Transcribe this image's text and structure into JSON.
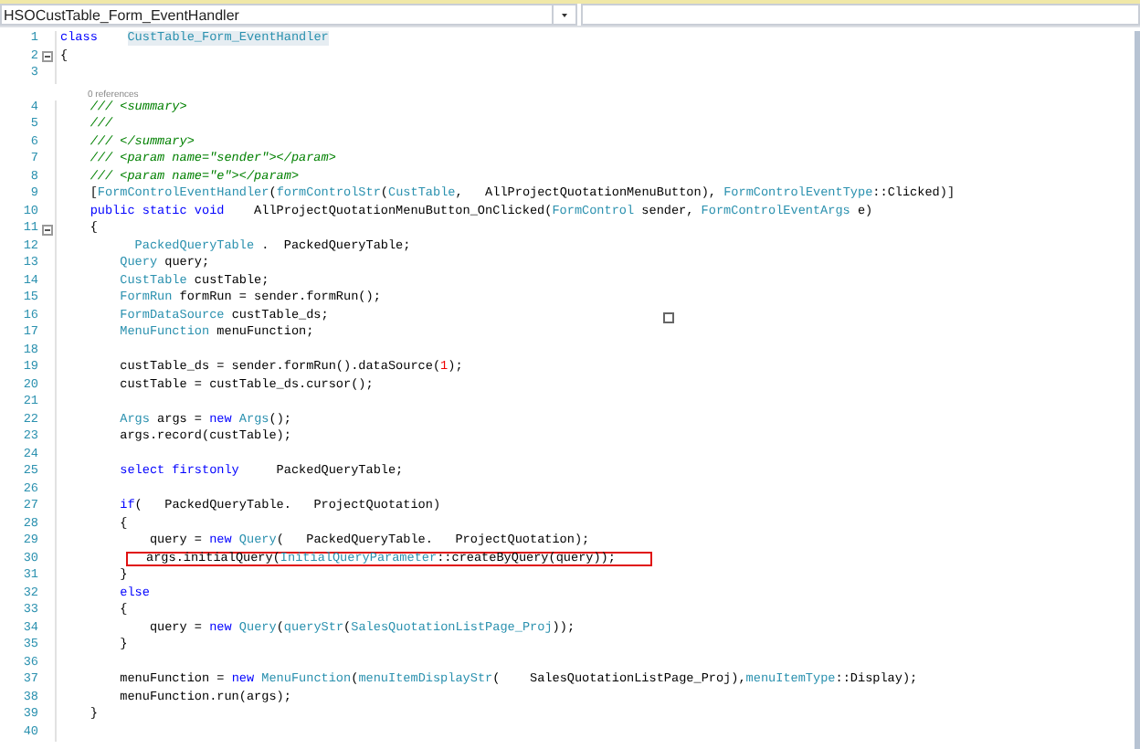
{
  "navigation": {
    "type_dropdown": "HSOCustTable_Form_EventHandler"
  },
  "editor": {
    "lines": [
      {
        "number": "1",
        "collapsible": false,
        "boxed": false,
        "tokens": [
          {
            "kind": "keyword",
            "text": "class    "
          },
          {
            "kind": "highlight",
            "text": "CustTable_Form_EventHandler"
          }
        ]
      },
      {
        "number": "2",
        "collapsible": true,
        "boxed": false,
        "tokens": [
          {
            "kind": "plain",
            "text": "{"
          }
        ]
      },
      {
        "number": "3",
        "collapsible": false,
        "boxed": false
      },
      {
        "number": "4",
        "collapsible": false,
        "boxed": false,
        "references": "0 references",
        "tokens": [
          {
            "kind": "comment",
            "text": "    /// <summary>"
          }
        ]
      },
      {
        "number": "5",
        "collapsible": false,
        "boxed": false,
        "tokens": [
          {
            "kind": "comment",
            "text": "    ///"
          }
        ]
      },
      {
        "number": "6",
        "collapsible": false,
        "boxed": false,
        "tokens": [
          {
            "kind": "comment",
            "text": "    /// </summary>"
          }
        ]
      },
      {
        "number": "7",
        "collapsible": false,
        "boxed": false,
        "tokens": [
          {
            "kind": "comment",
            "text": "    /// <param name=\"sender\"></param>"
          }
        ]
      },
      {
        "number": "8",
        "collapsible": false,
        "boxed": false,
        "tokens": [
          {
            "kind": "comment",
            "text": "    /// <param name=\"e\"></param>"
          }
        ]
      },
      {
        "number": "9",
        "collapsible": false,
        "boxed": false,
        "tokens": [
          {
            "kind": "plain",
            "text": "    ["
          },
          {
            "kind": "type",
            "text": "FormControlEventHandler"
          },
          {
            "kind": "plain",
            "text": "("
          },
          {
            "kind": "type",
            "text": "formControlStr"
          },
          {
            "kind": "plain",
            "text": "("
          },
          {
            "kind": "type",
            "text": "CustTable"
          },
          {
            "kind": "plain",
            "text": ",   AllProjectQuotationMenuButton), "
          },
          {
            "kind": "type",
            "text": "FormControlEventType"
          },
          {
            "kind": "plain",
            "text": "::Clicked)]"
          }
        ]
      },
      {
        "number": "10",
        "collapsible": false,
        "boxed": false,
        "tokens": [
          {
            "kind": "keyword",
            "text": "    public static void"
          },
          {
            "kind": "plain",
            "text": "    AllProjectQuotationMenuButton_OnClicked("
          },
          {
            "kind": "type",
            "text": "FormControl"
          },
          {
            "kind": "plain",
            "text": " sender, "
          },
          {
            "kind": "type",
            "text": "FormControlEventArgs"
          },
          {
            "kind": "plain",
            "text": " e)"
          }
        ]
      },
      {
        "number": "11",
        "collapsible": true,
        "boxed": false,
        "tokens": [
          {
            "kind": "plain",
            "text": "    {"
          }
        ]
      },
      {
        "number": "12",
        "collapsible": false,
        "boxed": false,
        "tokens": [
          {
            "kind": "type",
            "text": "          PackedQueryTable"
          },
          {
            "kind": "plain",
            "text": " .  PackedQueryTable;"
          }
        ]
      },
      {
        "number": "13",
        "collapsible": false,
        "boxed": false,
        "tokens": [
          {
            "kind": "type",
            "text": "        Query"
          },
          {
            "kind": "plain",
            "text": " query;"
          }
        ]
      },
      {
        "number": "14",
        "collapsible": false,
        "boxed": false,
        "tokens": [
          {
            "kind": "type",
            "text": "        CustTable"
          },
          {
            "kind": "plain",
            "text": " custTable;"
          }
        ]
      },
      {
        "number": "15",
        "collapsible": false,
        "boxed": false,
        "tokens": [
          {
            "kind": "type",
            "text": "        FormRun"
          },
          {
            "kind": "plain",
            "text": " formRun = sender.formRun();"
          }
        ]
      },
      {
        "number": "16",
        "collapsible": false,
        "boxed": false,
        "tokens": [
          {
            "kind": "type",
            "text": "        FormDataSource"
          },
          {
            "kind": "plain",
            "text": " custTable_ds;"
          }
        ]
      },
      {
        "number": "17",
        "collapsible": false,
        "boxed": false,
        "tokens": [
          {
            "kind": "type",
            "text": "        MenuFunction"
          },
          {
            "kind": "plain",
            "text": " menuFunction;"
          }
        ]
      },
      {
        "number": "18",
        "collapsible": false,
        "boxed": false
      },
      {
        "number": "19",
        "collapsible": false,
        "boxed": false,
        "tokens": [
          {
            "kind": "plain",
            "text": "        custTable_ds = sender.formRun().dataSource("
          },
          {
            "kind": "number",
            "text": "1"
          },
          {
            "kind": "plain",
            "text": ");"
          }
        ]
      },
      {
        "number": "20",
        "collapsible": false,
        "boxed": false,
        "tokens": [
          {
            "kind": "plain",
            "text": "        custTable = custTable_ds.cursor();"
          }
        ]
      },
      {
        "number": "21",
        "collapsible": false,
        "boxed": false
      },
      {
        "number": "22",
        "collapsible": false,
        "boxed": false,
        "tokens": [
          {
            "kind": "type",
            "text": "        Args"
          },
          {
            "kind": "plain",
            "text": " args = "
          },
          {
            "kind": "keyword",
            "text": "new "
          },
          {
            "kind": "type",
            "text": "Args"
          },
          {
            "kind": "plain",
            "text": "();"
          }
        ]
      },
      {
        "number": "23",
        "collapsible": false,
        "boxed": false,
        "tokens": [
          {
            "kind": "plain",
            "text": "        args.record(custTable);"
          }
        ]
      },
      {
        "number": "24",
        "collapsible": false,
        "boxed": false
      },
      {
        "number": "25",
        "collapsible": false,
        "boxed": false,
        "tokens": [
          {
            "kind": "keyword",
            "text": "        select firstonly"
          },
          {
            "kind": "plain",
            "text": "     PackedQueryTable;"
          }
        ]
      },
      {
        "number": "26",
        "collapsible": false,
        "boxed": false
      },
      {
        "number": "27",
        "collapsible": false,
        "boxed": false,
        "tokens": [
          {
            "kind": "keyword",
            "text": "        if"
          },
          {
            "kind": "plain",
            "text": "(   PackedQueryTable.   ProjectQuotation)"
          }
        ]
      },
      {
        "number": "28",
        "collapsible": false,
        "boxed": false,
        "tokens": [
          {
            "kind": "plain",
            "text": "        {"
          }
        ]
      },
      {
        "number": "29",
        "collapsible": false,
        "boxed": false,
        "tokens": [
          {
            "kind": "plain",
            "text": "            query = "
          },
          {
            "kind": "keyword",
            "text": "new "
          },
          {
            "kind": "type",
            "text": "Query"
          },
          {
            "kind": "plain",
            "text": "(   PackedQueryTable.   ProjectQuotation);"
          }
        ]
      },
      {
        "number": "30",
        "collapsible": false,
        "boxed": true,
        "tokens": [
          {
            "kind": "plain",
            "text": "args.initialQuery("
          },
          {
            "kind": "type",
            "text": "InitialQueryParameter"
          },
          {
            "kind": "plain",
            "text": "::createByQuery(query));"
          }
        ]
      },
      {
        "number": "31",
        "collapsible": false,
        "boxed": false,
        "tokens": [
          {
            "kind": "plain",
            "text": "        }"
          }
        ]
      },
      {
        "number": "32",
        "collapsible": false,
        "boxed": false,
        "tokens": [
          {
            "kind": "keyword",
            "text": "        else"
          }
        ]
      },
      {
        "number": "33",
        "collapsible": false,
        "boxed": false,
        "tokens": [
          {
            "kind": "plain",
            "text": "        {"
          }
        ]
      },
      {
        "number": "34",
        "collapsible": false,
        "boxed": false,
        "tokens": [
          {
            "kind": "plain",
            "text": "            query = "
          },
          {
            "kind": "keyword",
            "text": "new "
          },
          {
            "kind": "type",
            "text": "Query"
          },
          {
            "kind": "plain",
            "text": "("
          },
          {
            "kind": "type",
            "text": "queryStr"
          },
          {
            "kind": "plain",
            "text": "("
          },
          {
            "kind": "type",
            "text": "SalesQuotationListPage_Proj"
          },
          {
            "kind": "plain",
            "text": "));"
          }
        ]
      },
      {
        "number": "35",
        "collapsible": false,
        "boxed": false,
        "tokens": [
          {
            "kind": "plain",
            "text": "        }"
          }
        ]
      },
      {
        "number": "36",
        "collapsible": false,
        "boxed": false
      },
      {
        "number": "37",
        "collapsible": false,
        "boxed": false,
        "tokens": [
          {
            "kind": "plain",
            "text": "        menuFunction = "
          },
          {
            "kind": "keyword",
            "text": "new "
          },
          {
            "kind": "type",
            "text": "MenuFunction"
          },
          {
            "kind": "plain",
            "text": "("
          },
          {
            "kind": "type",
            "text": "menuItemDisplayStr"
          },
          {
            "kind": "plain",
            "text": "(    SalesQuotationListPage_Proj),"
          },
          {
            "kind": "type",
            "text": "menuItemType"
          },
          {
            "kind": "plain",
            "text": "::Display);"
          }
        ]
      },
      {
        "number": "38",
        "collapsible": false,
        "boxed": false,
        "tokens": [
          {
            "kind": "plain",
            "text": "        menuFunction.run(args);"
          }
        ]
      },
      {
        "number": "39",
        "collapsible": false,
        "boxed": false,
        "tokens": [
          {
            "kind": "plain",
            "text": "    }"
          }
        ]
      },
      {
        "number": "40",
        "collapsible": false,
        "boxed": false
      }
    ]
  }
}
